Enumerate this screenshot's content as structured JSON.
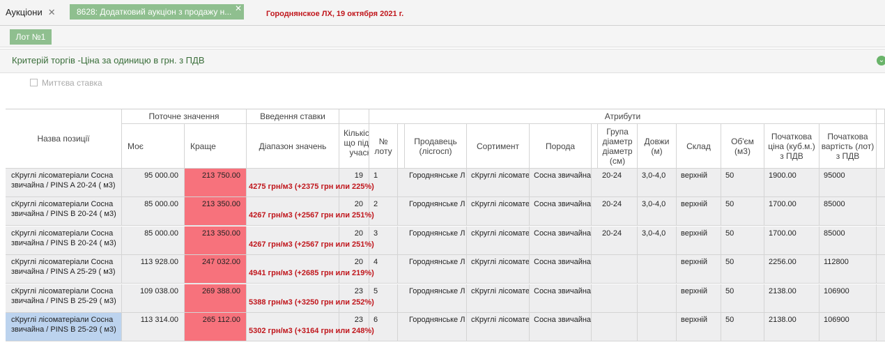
{
  "tabs": [
    {
      "label": "Аукціони",
      "close": "✕"
    },
    {
      "label": "8628: Додатковий аукціон з продажу н...",
      "close": "✕"
    }
  ],
  "header_text": "Городнянское ЛХ, 19 октября 2021 г.",
  "lot_button": "Лот №1",
  "criteria": {
    "title": "Критерій торгів -Ціна за одиницю в грн. з ПДВ",
    "chevron_icon": "chevron-down-circle-icon"
  },
  "instant_bid": {
    "label": "Миттєва ставка",
    "checked": false
  },
  "table": {
    "group_headers": {
      "current": "Поточне значення",
      "bid_input": "Введення ставки",
      "attributes": "Атрибути"
    },
    "columns": {
      "name": "Назва позиції",
      "mine": "Моє",
      "best": "Краще",
      "range": "Діапазон значень",
      "count": "Кількість, що підтв. учасн.",
      "no": "№ лоту",
      "seller": "Продавець (лісгосп)",
      "assortment": "Сортимент",
      "species": "Порода",
      "diameter": "Група діаметр діаметр (см)",
      "length": "Довжи (м)",
      "warehouse": "Склад",
      "volume": "Об'єм (м3)",
      "start_price": "Початкова ціна (куб.м.) з ПДВ",
      "start_cost": "Початкова вартість (лот) з ПДВ"
    },
    "rows": [
      {
        "name": "сКруглі лісоматеріали Сосна звичайна / PINS A 20-24 ( м3)",
        "mine": "95 000.00",
        "best": "213 750.00",
        "range": "4275 грн/м3 (+2375 грн или 225%)",
        "count": "19",
        "no": "1",
        "seller": "Городнянське Л",
        "assortment": "сКруглі лісомате",
        "species": "Сосна звичайна",
        "diameter": "20-24",
        "length": "3,0-4,0",
        "warehouse": "верхній",
        "volume": "50",
        "start_price": "1900.00",
        "start_cost": "95000"
      },
      {
        "name": "сКруглі лісоматеріали Сосна звичайна / PINS B 20-24 ( м3)",
        "mine": "85 000.00",
        "best": "213 350.00",
        "range": "4267 грн/м3 (+2567 грн или 251%)",
        "count": "20",
        "no": "2",
        "seller": "Городнянське Л",
        "assortment": "сКруглі лісомате",
        "species": "Сосна звичайна",
        "diameter": "20-24",
        "length": "3,0-4,0",
        "warehouse": "верхній",
        "volume": "50",
        "start_price": "1700.00",
        "start_cost": "85000"
      },
      {
        "name": "сКруглі лісоматеріали Сосна звичайна / PINS B 20-24 ( м3)",
        "mine": "85 000.00",
        "best": "213 350.00",
        "range": "4267 грн/м3 (+2567 грн или 251%)",
        "count": "20",
        "no": "3",
        "seller": "Городнянське Л",
        "assortment": "сКруглі лісомате",
        "species": "Сосна звичайна",
        "diameter": "20-24",
        "length": "3,0-4,0",
        "warehouse": "верхній",
        "volume": "50",
        "start_price": "1700.00",
        "start_cost": "85000"
      },
      {
        "name": "сКруглі лісоматеріали Сосна звичайна / PINS A 25-29 ( м3)",
        "mine": "113 928.00",
        "best": "247 032.00",
        "range": "4941 грн/м3 (+2685 грн или 219%)",
        "count": "20",
        "no": "4",
        "seller": "Городнянське Л",
        "assortment": "сКруглі лісомате",
        "species": "Сосна звичайна",
        "diameter": "",
        "length": "",
        "warehouse": "верхній",
        "volume": "50",
        "start_price": "2256.00",
        "start_cost": "112800"
      },
      {
        "name": "сКруглі лісоматеріали Сосна звичайна / PINS B 25-29 ( м3)",
        "mine": "109 038.00",
        "best": "269 388.00",
        "range": "5388 грн/м3 (+3250 грн или 252%)",
        "count": "23",
        "no": "5",
        "seller": "Городнянське Л",
        "assortment": "сКруглі лісомате",
        "species": "Сосна звичайна",
        "diameter": "",
        "length": "",
        "warehouse": "верхній",
        "volume": "50",
        "start_price": "2138.00",
        "start_cost": "106900"
      },
      {
        "name": "сКруглі лісоматеріали Сосна звичайна / PINS B 25-29 ( м3)",
        "mine": "113 314.00",
        "best": "265 112.00",
        "range": "5302 грн/м3 (+3164 грн или 248%)",
        "count": "23",
        "no": "6",
        "seller": "Городнянське Л",
        "assortment": "сКруглі лісомате",
        "species": "Сосна звичайна",
        "diameter": "",
        "length": "",
        "warehouse": "верхній",
        "volume": "50",
        "start_price": "2138.00",
        "start_cost": "106900",
        "selected": true
      }
    ]
  }
}
